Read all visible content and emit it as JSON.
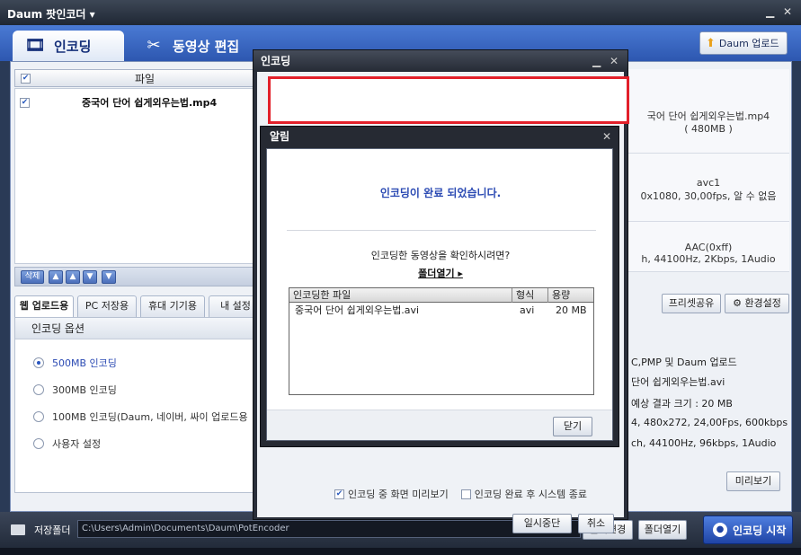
{
  "window": {
    "title": "Daum 팟인코더 ▾",
    "minimize": "▁",
    "close": "✕"
  },
  "header": {
    "tabs": [
      {
        "label": "인코딩",
        "icon": "film-reel-icon"
      },
      {
        "label": "동영상 편집",
        "icon": "scissors-icon"
      }
    ],
    "upload_label": "Daum 업로드"
  },
  "file_list": {
    "header_label": "파일",
    "files": [
      {
        "name": "중국어 단어 쉽게외우는법.mp4",
        "checked": true
      }
    ],
    "toolbar": {
      "delete_label": "삭제",
      "up_first": "▲",
      "up": "▲",
      "down": "▼",
      "down_last": "▼"
    }
  },
  "info_panel": {
    "file_line1": "국어 단어 쉽게외우는법.mp4",
    "file_line2": "( 480MB )",
    "video_line1": "avc1",
    "video_line2": "0x1080, 30,00fps, 알 수 없음",
    "audio_line1": "AAC(0xff)",
    "audio_line2": "h, 44100Hz, 2Kbps, 1Audio"
  },
  "subtabs": [
    "웹 업로드용",
    "PC 저장용",
    "휴대 기기용",
    "내 설정"
  ],
  "right_buttons": {
    "preset_share": "프리셋공유",
    "settings": "환경설정",
    "preview": "미리보기"
  },
  "options": {
    "title": "인코딩 옵션",
    "radios": [
      {
        "label": "500MB 인코딩",
        "selected": true
      },
      {
        "label": "300MB 인코딩",
        "selected": false
      },
      {
        "label": "100MB 인코딩(Daum, 네이버, 싸이 업로드용",
        "selected": false
      },
      {
        "label": "사용자 설정",
        "selected": false
      }
    ]
  },
  "right_info": {
    "line1": "C,PMP 및 Daum 업로드",
    "line2": "단어 쉽게외우는법.avi",
    "line3": "예상 결과 크기 : 20 MB",
    "line4": "4, 480x272, 24,00Fps, 600kbps",
    "line5": "ch, 44100Hz, 96kbps, 1Audio"
  },
  "bottom": {
    "folder_label": "저장폴더",
    "path": "C:\\Users\\Admin\\Documents\\Daum\\PotEncoder",
    "change_folder": "폴더변경",
    "open_folder": "폴더열기",
    "start": "인코딩 시작"
  },
  "encoding_dialog": {
    "title": "인코딩",
    "preview_during": "인코딩 중 화면 미리보기",
    "shutdown_after": "인코딩 완료 후 시스템 종료",
    "pause": "일시중단",
    "cancel": "취소"
  },
  "alert": {
    "title": "알림",
    "message": "인코딩이 완료 되었습니다.",
    "question": "인코딩한 동영상을 확인하시려면?",
    "open_folder": "폴더열기 ▸",
    "table_headers": [
      "인코딩한 파일",
      "형식",
      "용량"
    ],
    "rows": [
      {
        "file": "중국어 단어 쉽게외우는법.avi",
        "format": "avi",
        "size": "20 MB"
      }
    ],
    "close": "닫기"
  },
  "colors": {
    "accent": "#2d57b0",
    "alert_text": "#2b4ab3",
    "highlight_box": "#e2202a"
  }
}
